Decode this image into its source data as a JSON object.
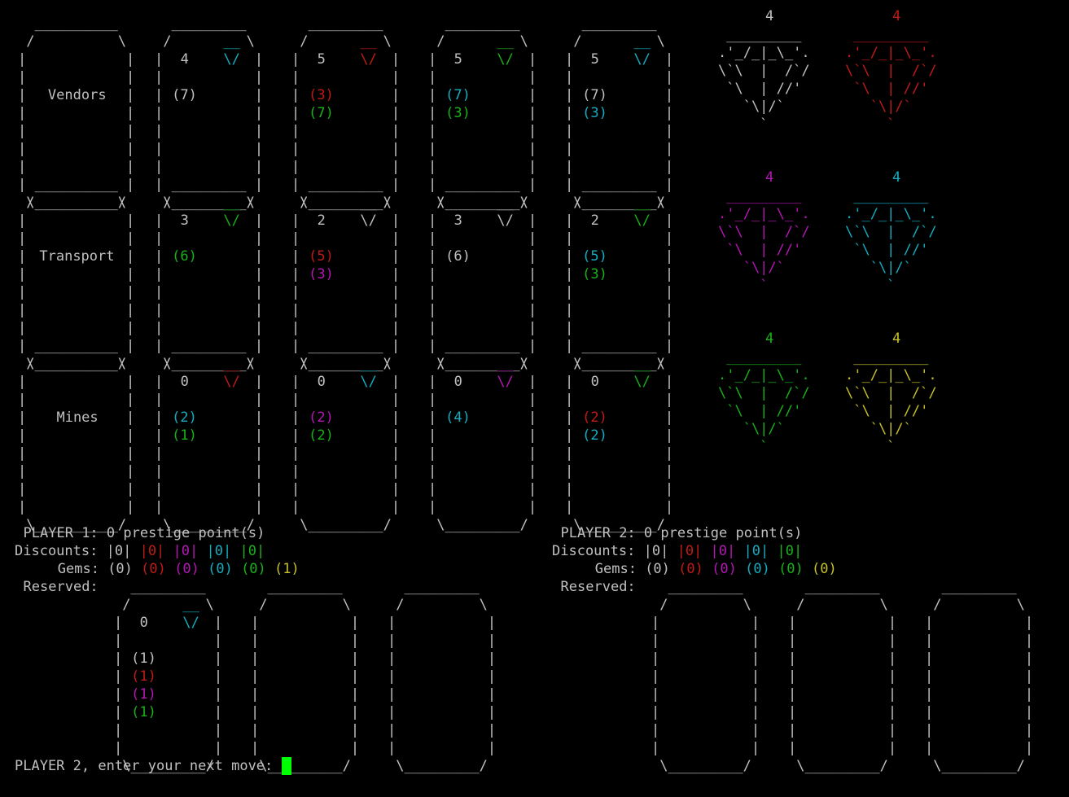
{
  "colors": {
    "white": "#c0c0c0",
    "red": "#c11b17",
    "magenta": "#b516b5",
    "cyan": "#14adc0",
    "green": "#18b218",
    "yellow": "#c6c12a",
    "cursor": "#00ff00"
  },
  "board": {
    "rows": [
      {
        "label": "Vendors",
        "cards": [
          {
            "points": "4",
            "gem": "cyan",
            "costs": [
              {
                "v": "(7)",
                "c": "white"
              }
            ]
          },
          {
            "points": "5",
            "gem": "red",
            "costs": [
              {
                "v": "(3)",
                "c": "red"
              },
              {
                "v": "(7)",
                "c": "green"
              }
            ]
          },
          {
            "points": "5",
            "gem": "green",
            "costs": [
              {
                "v": "(7)",
                "c": "cyan"
              },
              {
                "v": "(3)",
                "c": "green"
              }
            ]
          },
          {
            "points": "5",
            "gem": "cyan",
            "costs": [
              {
                "v": "(7)",
                "c": "white"
              },
              {
                "v": "(3)",
                "c": "cyan"
              }
            ]
          }
        ]
      },
      {
        "label": "Transport",
        "cards": [
          {
            "points": "3",
            "gem": "green",
            "costs": [
              {
                "v": "(6)",
                "c": "green"
              }
            ]
          },
          {
            "points": "2",
            "gem": "white",
            "costs": [
              {
                "v": "(5)",
                "c": "red"
              },
              {
                "v": "(3)",
                "c": "magenta"
              }
            ]
          },
          {
            "points": "3",
            "gem": "white",
            "costs": [
              {
                "v": "(6)",
                "c": "white"
              }
            ]
          },
          {
            "points": "2",
            "gem": "green",
            "costs": [
              {
                "v": "(5)",
                "c": "cyan"
              },
              {
                "v": "(3)",
                "c": "green"
              }
            ]
          }
        ]
      },
      {
        "label": "Mines",
        "cards": [
          {
            "points": "0",
            "gem": "red",
            "costs": [
              {
                "v": "(2)",
                "c": "cyan"
              },
              {
                "v": "(1)",
                "c": "green"
              }
            ]
          },
          {
            "points": "0",
            "gem": "cyan",
            "costs": [
              {
                "v": "(2)",
                "c": "magenta"
              },
              {
                "v": "(2)",
                "c": "green"
              }
            ]
          },
          {
            "points": "0",
            "gem": "magenta",
            "costs": [
              {
                "v": "(4)",
                "c": "cyan"
              }
            ]
          },
          {
            "points": "0",
            "gem": "green",
            "costs": [
              {
                "v": "(2)",
                "c": "red"
              },
              {
                "v": "(2)",
                "c": "cyan"
              }
            ]
          }
        ]
      }
    ],
    "bank": [
      {
        "count": "4",
        "color": "white"
      },
      {
        "count": "4",
        "color": "red"
      },
      {
        "count": "4",
        "color": "magenta"
      },
      {
        "count": "4",
        "color": "cyan"
      },
      {
        "count": "4",
        "color": "green"
      },
      {
        "count": "4",
        "color": "yellow"
      }
    ]
  },
  "players": [
    {
      "header": "PLAYER 1: 0 prestige point(s)",
      "discounts_label": "Discounts:",
      "discounts": [
        {
          "v": "|0|",
          "c": "white"
        },
        {
          "v": "|0|",
          "c": "red"
        },
        {
          "v": "|0|",
          "c": "magenta"
        },
        {
          "v": "|0|",
          "c": "cyan"
        },
        {
          "v": "|0|",
          "c": "green"
        }
      ],
      "gems_label": "Gems:",
      "gems": [
        {
          "v": "(0)",
          "c": "white"
        },
        {
          "v": "(0)",
          "c": "red"
        },
        {
          "v": "(0)",
          "c": "magenta"
        },
        {
          "v": "(0)",
          "c": "cyan"
        },
        {
          "v": "(0)",
          "c": "green"
        },
        {
          "v": "(1)",
          "c": "yellow"
        }
      ],
      "reserved_label": "Reserved:",
      "reserved": [
        {
          "points": "0",
          "gem": "cyan",
          "costs": [
            {
              "v": "(1)",
              "c": "white"
            },
            {
              "v": "(1)",
              "c": "red"
            },
            {
              "v": "(1)",
              "c": "magenta"
            },
            {
              "v": "(1)",
              "c": "green"
            }
          ]
        },
        null,
        null
      ]
    },
    {
      "header": "PLAYER 2: 0 prestige point(s)",
      "discounts_label": "Discounts:",
      "discounts": [
        {
          "v": "|0|",
          "c": "white"
        },
        {
          "v": "|0|",
          "c": "red"
        },
        {
          "v": "|0|",
          "c": "magenta"
        },
        {
          "v": "|0|",
          "c": "cyan"
        },
        {
          "v": "|0|",
          "c": "green"
        }
      ],
      "gems_label": "Gems:",
      "gems": [
        {
          "v": "(0)",
          "c": "white"
        },
        {
          "v": "(0)",
          "c": "red"
        },
        {
          "v": "(0)",
          "c": "magenta"
        },
        {
          "v": "(0)",
          "c": "cyan"
        },
        {
          "v": "(0)",
          "c": "green"
        },
        {
          "v": "(0)",
          "c": "yellow"
        }
      ],
      "reserved_label": "Reserved:",
      "reserved": [
        null,
        null,
        null
      ]
    }
  ],
  "prompt": "PLAYER 2, enter your next move: "
}
